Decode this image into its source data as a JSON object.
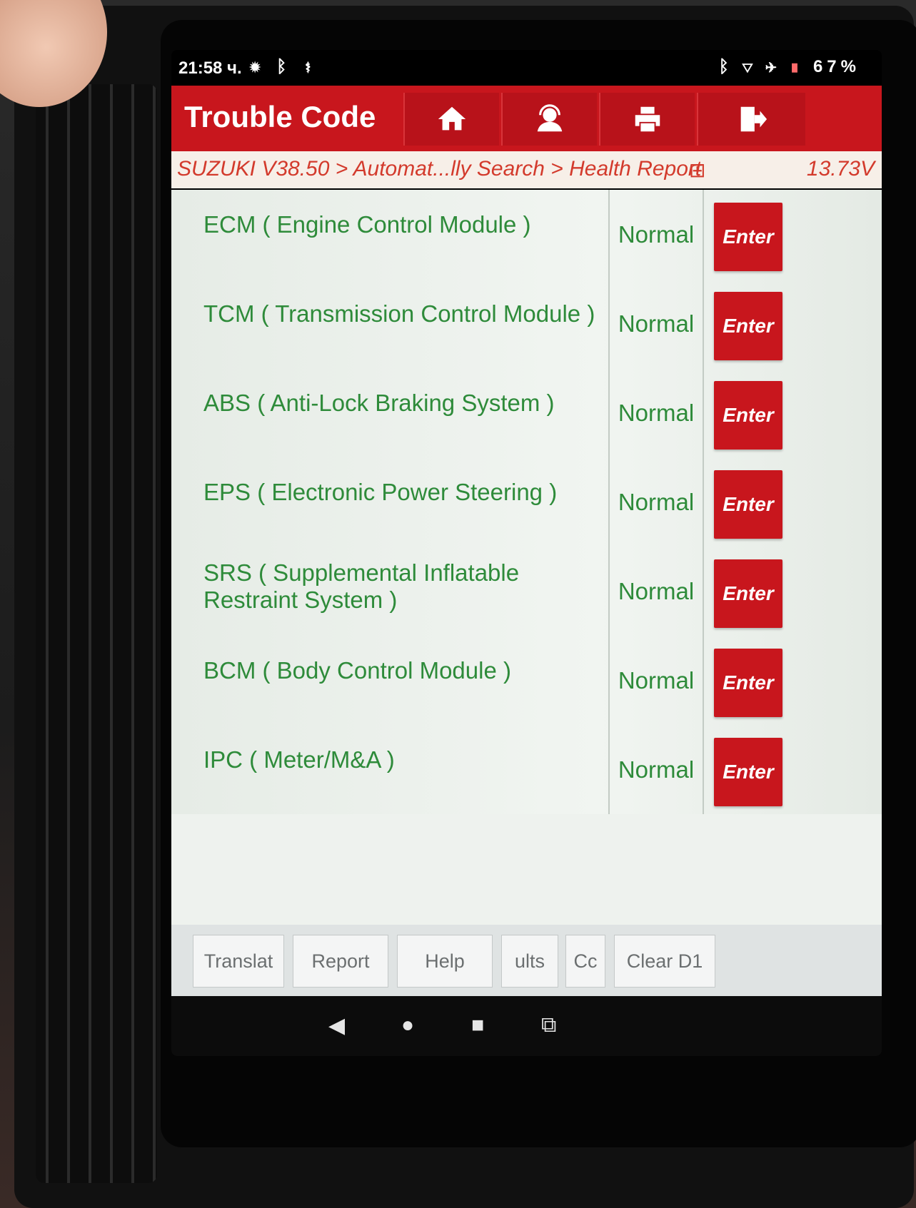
{
  "status_bar": {
    "time": "21:58 ч.",
    "left_icons": [
      "gear-icon",
      "bluetooth-icon",
      "stethoscope-icon"
    ],
    "right_icons": [
      "bluetooth-icon",
      "wifi-icon",
      "airplane-icon",
      "battery-icon"
    ],
    "battery_percent": "67%"
  },
  "header": {
    "title": "Trouble Code",
    "buttons": [
      "home-icon",
      "support-icon",
      "print-icon",
      "exit-icon"
    ]
  },
  "breadcrumb": {
    "path": "SUZUKI V38.50 > Automat...lly Search > Health Report",
    "voltage": "13.73V"
  },
  "modules": [
    {
      "name": "ECM ( Engine Control Module )",
      "status": "Normal",
      "action": "Enter"
    },
    {
      "name": "TCM ( Transmission Control Module )",
      "status": "Normal",
      "action": "Enter"
    },
    {
      "name": "ABS ( Anti-Lock Braking System )",
      "status": "Normal",
      "action": "Enter"
    },
    {
      "name": "EPS ( Electronic Power Steering )",
      "status": "Normal",
      "action": "Enter"
    },
    {
      "name": "SRS ( Supplemental Inflatable Restraint System )",
      "status": "Normal",
      "action": "Enter"
    },
    {
      "name": "BCM ( Body Control Module )",
      "status": "Normal",
      "action": "Enter"
    },
    {
      "name": "IPC ( Meter/M&A )",
      "status": "Normal",
      "action": "Enter"
    }
  ],
  "toolbar": {
    "translate": "Translat",
    "report": "Report",
    "help": "Help",
    "results": "ults",
    "clear_codes_partial": "Cc",
    "clear_dtc": "Clear D1"
  },
  "colors": {
    "accent": "#c8161d",
    "status_text": "#2e8b3a",
    "breadcrumb_text": "#d33a2c"
  }
}
